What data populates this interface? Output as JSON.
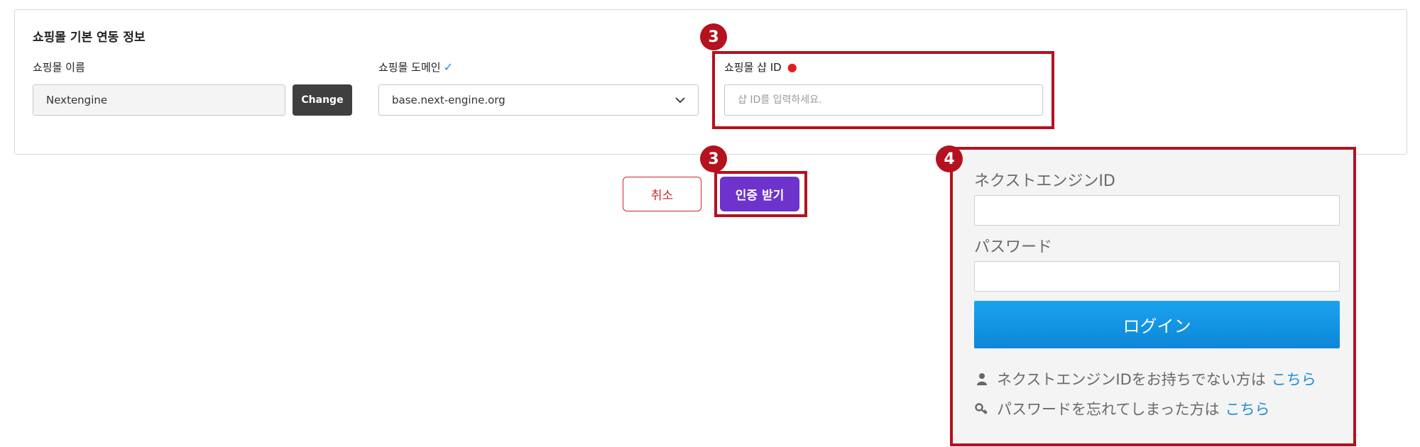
{
  "section": {
    "title": "쇼핑몰 기본 연동 정보"
  },
  "fields": {
    "mall_name": {
      "label": "쇼핑몰 이름",
      "value": "Nextengine",
      "change_label": "Change"
    },
    "mall_domain": {
      "label": "쇼핑몰 도메인",
      "check_glyph": "✓",
      "value": "base.next-engine.org",
      "chevron": "⌄"
    },
    "shop_id": {
      "label": "쇼핑몰 샵 ID",
      "required_glyph": "●",
      "placeholder": "샵 ID를 입력하세요."
    }
  },
  "actions": {
    "cancel_label": "취소",
    "auth_label": "인증 받기"
  },
  "badges": {
    "shop_id_step": "3",
    "auth_step": "3",
    "login_step": "4"
  },
  "login": {
    "id_label": "ネクストエンジンID",
    "password_label": "パスワード",
    "login_button": "ログイン",
    "signup_text": "ネクストエンジンIDをお持ちでない方は",
    "signup_link": "こちら",
    "forgot_text": "パスワードを忘れてしまった方は",
    "forgot_link": "こちら"
  },
  "colors": {
    "annotation_red": "#b3121e",
    "auth_purple": "#6d33cc",
    "login_blue": "#1aa3f0",
    "link_blue": "#1f8fd6",
    "check_blue": "#1a8fd6"
  },
  "icons": {
    "check": "check-icon",
    "chevron": "chevron-down-icon",
    "user": "user-icon",
    "key": "key-icon"
  }
}
